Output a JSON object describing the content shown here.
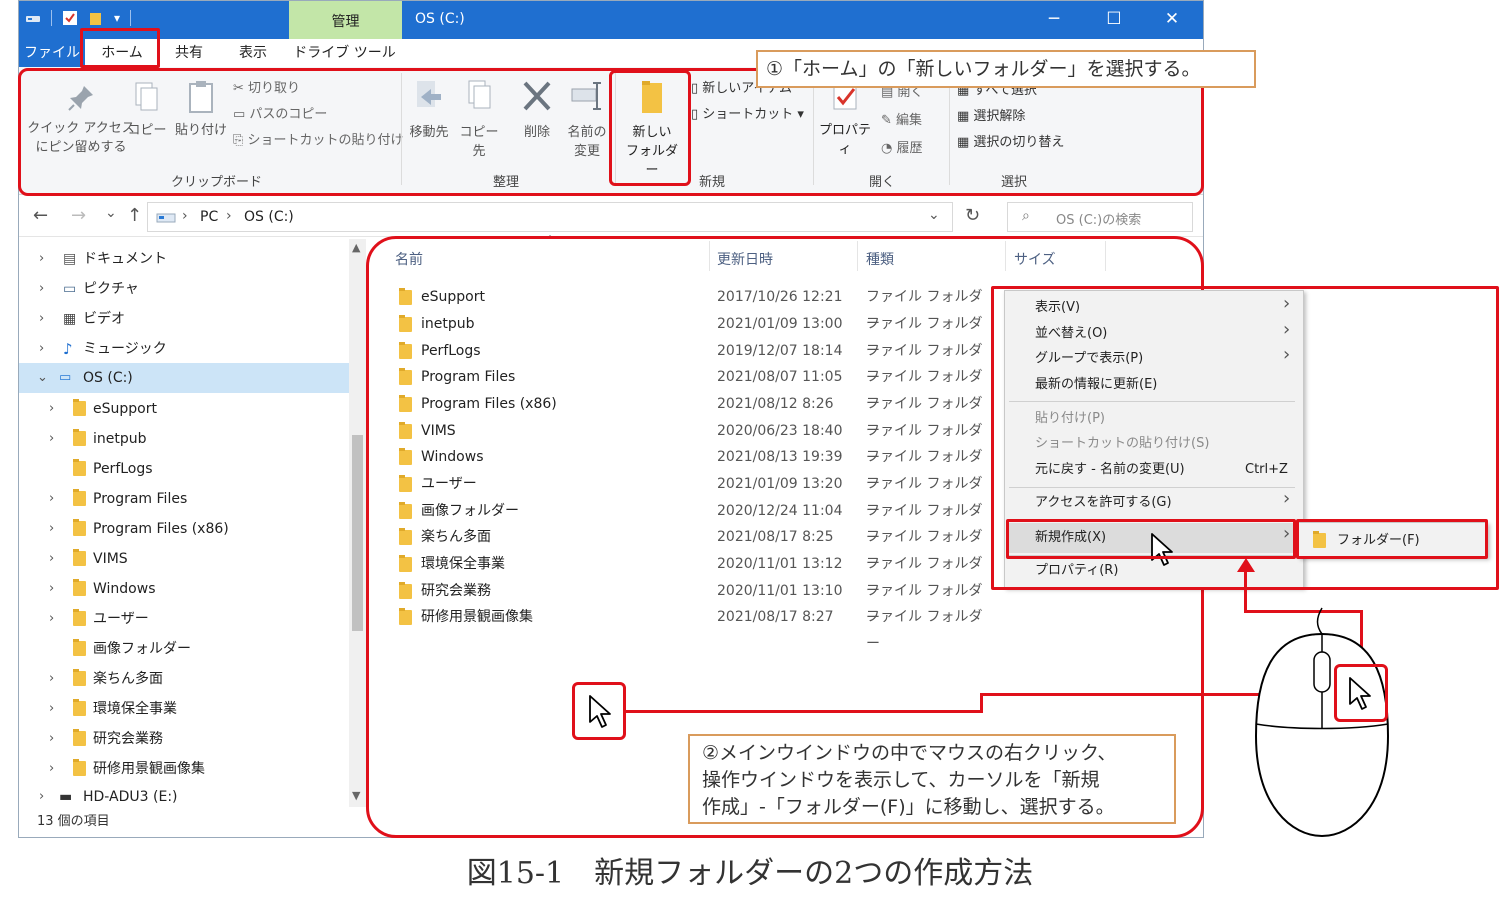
{
  "window": {
    "manage_tab": "管理",
    "title": "OS (C:)",
    "minimize": "─",
    "maximize": "☐",
    "close": "✕"
  },
  "tabs": [
    "ファイル",
    "ホーム",
    "共有",
    "表示",
    "ドライブ ツール"
  ],
  "ribbon": {
    "pin_label_1": "クイック アクセス",
    "pin_label_2": "にピン留めする",
    "copy": "コピー",
    "paste": "貼り付け",
    "cut": "切り取り",
    "copy_path": "パスのコピー",
    "paste_shortcut": "ショートカットの貼り付け",
    "clipboard_group": "クリップボード",
    "move_to": "移動先",
    "copy_to": "コピー先",
    "delete": "削除",
    "rename_1": "名前の",
    "rename_2": "変更",
    "organize_group": "整理",
    "new_folder_1": "新しい",
    "new_folder_2": "フォルダー",
    "new_item": "新しいアイテム",
    "shortcut": "ショートカット ▾",
    "new_group": "新規",
    "properties": "プロパティ",
    "open_item": "開く",
    "edit": "編集",
    "history": "履歴",
    "open_group": "開く",
    "select_all": "すべて選択",
    "select_none": "選択解除",
    "invert_selection": "選択の切り替え",
    "select_group": "選択"
  },
  "address": {
    "back": "←",
    "forward": "→",
    "recent": "⌄",
    "up": "↑",
    "crumb_pc": "PC",
    "crumb_drive": "OS (C:)",
    "refresh": "↻",
    "search_placeholder": "OS (C:)の検索"
  },
  "nav": {
    "items": [
      {
        "label": "ドキュメント"
      },
      {
        "label": "ピクチャ"
      },
      {
        "label": "ビデオ"
      },
      {
        "label": "ミュージック"
      },
      {
        "label": "OS (C:)"
      },
      {
        "label": "eSupport"
      },
      {
        "label": "inetpub"
      },
      {
        "label": "PerfLogs"
      },
      {
        "label": "Program Files"
      },
      {
        "label": "Program Files (x86)"
      },
      {
        "label": "VIMS"
      },
      {
        "label": "Windows"
      },
      {
        "label": "ユーザー"
      },
      {
        "label": "画像フォルダー"
      },
      {
        "label": "楽ちん多面"
      },
      {
        "label": "環境保全事業"
      },
      {
        "label": "研究会業務"
      },
      {
        "label": "研修用景観画像集"
      },
      {
        "label": "HD-ADU3 (E:)"
      }
    ]
  },
  "files": {
    "columns": {
      "name": "名前",
      "date": "更新日時",
      "kind": "種類",
      "size": "サイズ"
    },
    "rows": [
      {
        "name": "eSupport",
        "date": "2017/10/26 12:21",
        "kind": "ファイル フォルダー"
      },
      {
        "name": "inetpub",
        "date": "2021/01/09 13:00",
        "kind": "ファイル フォルダー"
      },
      {
        "name": "PerfLogs",
        "date": "2019/12/07 18:14",
        "kind": "ファイル フォルダー"
      },
      {
        "name": "Program Files",
        "date": "2021/08/07 11:05",
        "kind": "ファイル フォルダー"
      },
      {
        "name": "Program Files (x86)",
        "date": "2021/08/12 8:26",
        "kind": "ファイル フォルダー"
      },
      {
        "name": "VIMS",
        "date": "2020/06/23 18:40",
        "kind": "ファイル フォルダー"
      },
      {
        "name": "Windows",
        "date": "2021/08/13 19:39",
        "kind": "ファイル フォルダー"
      },
      {
        "name": "ユーザー",
        "date": "2021/01/09 13:20",
        "kind": "ファイル フォルダー"
      },
      {
        "name": "画像フォルダー",
        "date": "2020/12/24 11:04",
        "kind": "ファイル フォルダー"
      },
      {
        "name": "楽ちん多面",
        "date": "2021/08/17 8:25",
        "kind": "ファイル フォルダー"
      },
      {
        "name": "環境保全事業",
        "date": "2020/11/01 13:12",
        "kind": "ファイル フォルダー"
      },
      {
        "name": "研究会業務",
        "date": "2020/11/01 13:10",
        "kind": "ファイル フォルダー"
      },
      {
        "name": "研修用景観画像集",
        "date": "2021/08/17 8:27",
        "kind": "ファイル フォルダー"
      }
    ]
  },
  "status": {
    "count": "13 個の項目"
  },
  "context_menu": {
    "view": "表示(V)",
    "sort": "並べ替え(O)",
    "group": "グループで表示(P)",
    "refresh": "最新の情報に更新(E)",
    "paste": "貼り付け(P)",
    "paste_shortcut": "ショートカットの貼り付け(S)",
    "undo": "元に戻す - 名前の変更(U)",
    "undo_key": "Ctrl+Z",
    "give_access": "アクセスを許可する(G)",
    "new": "新規作成(X)",
    "properties": "プロパティ(R)",
    "submenu_folder": "フォルダー(F)"
  },
  "callouts": {
    "step1": "①「ホーム」の「新しいフォルダー」を選択する。",
    "step2_line1": "②メインウインドウの中でマウスの右クリック、",
    "step2_line2": "操作ウインドウを表示して、カーソルを「新規",
    "step2_line3": "作成」-「フォルダー(F)」に移動し、選択する。"
  },
  "caption": "図15-1　新規フォルダーの2つの作成方法",
  "colors": {
    "accent_blue": "#1f6fd0",
    "highlight_red": "#e0101a",
    "callout_border": "#d99b5c",
    "manage_green": "#c3e6a8"
  }
}
